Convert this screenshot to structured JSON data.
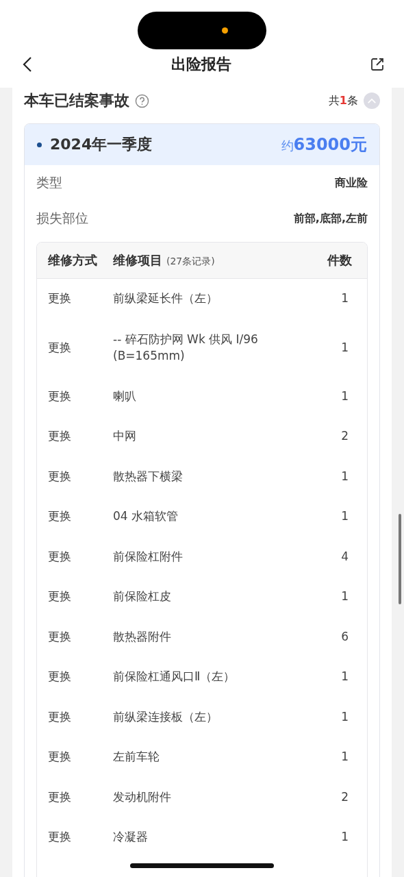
{
  "nav": {
    "title": "出险报告"
  },
  "section": {
    "title": "本车已结案事故",
    "count": "共**1**条",
    "expanded": true
  },
  "accident": {
    "period": "2024年一季度",
    "amount": "约**63000元**",
    "fields": [
      {
        "label": "类型",
        "value": "商业险"
      },
      {
        "label": "损失部位",
        "value": "前部,底部,左前"
      }
    ],
    "table": {
      "columns": [
        "维修方式",
        "维修项目",
        "件数"
      ],
      "records_note": "(27条记录)",
      "rows": [
        [
          "更换",
          "前纵梁延长件（左）",
          "1"
        ],
        [
          "更换",
          "-- 碎石防护网 Wk 供风 I/96 (B=165mm)",
          "1"
        ],
        [
          "更换",
          "喇叭",
          "1"
        ],
        [
          "更换",
          "中网",
          "2"
        ],
        [
          "更换",
          "散热器下横梁",
          "1"
        ],
        [
          "更换",
          "04 水箱软管",
          "1"
        ],
        [
          "更换",
          "前保险杠附件",
          "4"
        ],
        [
          "更换",
          "前保险杠皮",
          "1"
        ],
        [
          "更换",
          "散热器附件",
          "6"
        ],
        [
          "更换",
          "前保险杠通风口Ⅱ（左）",
          "1"
        ],
        [
          "更换",
          "前纵梁连接板（左）",
          "1"
        ],
        [
          "更换",
          "左前车轮",
          "1"
        ],
        [
          "更换",
          "发动机附件",
          "2"
        ],
        [
          "更换",
          "冷凝器",
          "1"
        ]
      ]
    }
  }
}
